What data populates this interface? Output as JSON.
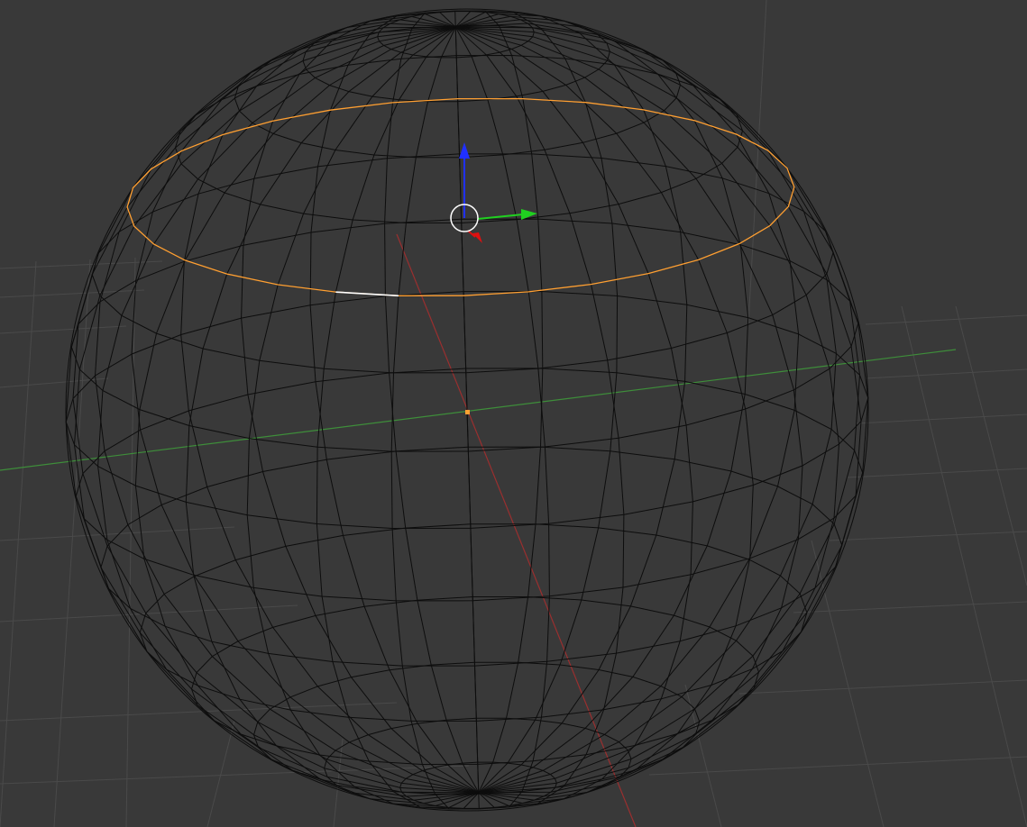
{
  "app": {
    "mode": "edit-mode-wireframe",
    "object_type": "uv-sphere",
    "selection": "edge-loop"
  },
  "colors": {
    "background": "#393939",
    "grid": "#4a4a4a",
    "wire": "#0d0d0d",
    "selected_loop": "#ffa033",
    "active_edge": "#ffffff",
    "axis_x": "#9a2f2f",
    "axis_y": "#3e8e3a",
    "gizmo_x": "#e01010",
    "gizmo_y": "#20d020",
    "gizmo_z": "#2030ff",
    "gizmo_center": "#ffffff",
    "origin_dot": "#ffa033"
  },
  "icons": {
    "gizmo_center": "circle-icon",
    "gizmo_x": "arrow-x-icon",
    "gizmo_y": "arrow-y-icon",
    "gizmo_z": "arrow-z-icon"
  }
}
